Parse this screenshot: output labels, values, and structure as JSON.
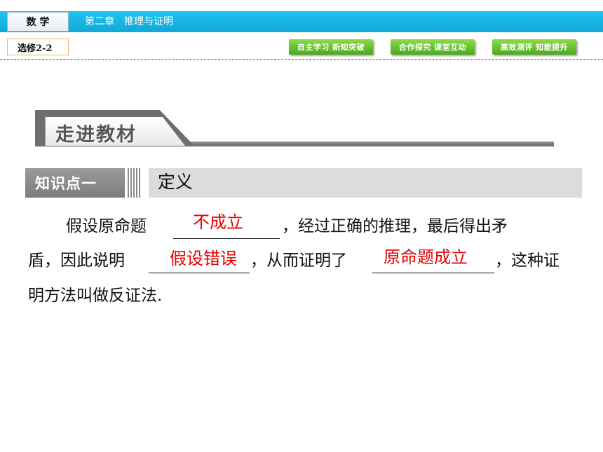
{
  "header": {
    "subject": "数 学",
    "chapter": "第二章　推理与证明",
    "volume": "选修2-2",
    "nav_buttons": [
      "自主学习 新知突破",
      "合作探究 课堂互动",
      "高效测评 知能提升"
    ]
  },
  "section": {
    "banner": "走进教材"
  },
  "knowledge_point": {
    "tag": "知识点一",
    "title": "定义"
  },
  "paragraph": {
    "line1_prefix": "假设原命题",
    "line1_suffix": "，经过正确的推理，最后得出矛",
    "line2_prefix": "盾，因此说明",
    "line2_middle": "，从而证明了",
    "line2_suffix": "，这种证",
    "line3": "明方法叫做反证法.",
    "answers": [
      "不成立",
      "假设错误",
      "原命题成立"
    ]
  },
  "colors": {
    "header_bar": "#16b4e2",
    "nav_button": "#5cb82a",
    "answer_text": "#e60000",
    "banner_gray": "#6e6e6e"
  }
}
